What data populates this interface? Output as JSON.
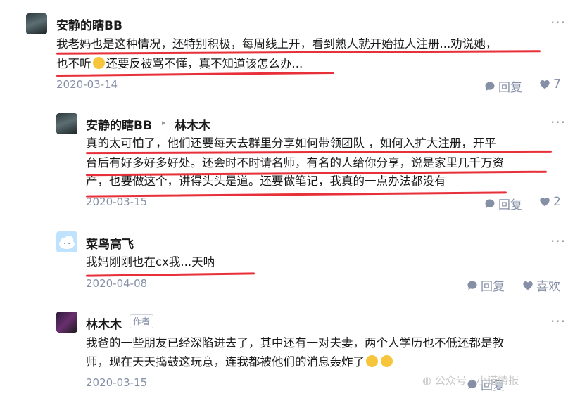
{
  "comments": [
    {
      "author": "安静的瞎BB",
      "text1": "我老妈也是这种情况，还特别积极，每周线上开，看到熟人就开始拉人注册...劝说她，",
      "text2a": "也不听",
      "text2b": "还要反被骂不懂，真不知道该怎么办...",
      "date": "2020-03-14",
      "reply_label": "回复",
      "likes": "7"
    },
    {
      "author": "安静的瞎BB",
      "reply_to": "林木木",
      "text1": "真的太可怕了，他们还要每天去群里分享如何带领团队 ，如何入扩大注册，开平",
      "text2": "台后有好多好多好处。还会时不时请名师，有名的人给你分享，说是家里几千万资",
      "text3": "产，也要做这个，讲得头头是道。还要做笔记，我真的一点办法都没有",
      "date": "2020-03-15",
      "reply_label": "回复",
      "likes": "2"
    },
    {
      "author": "菜鸟高飞",
      "text1": "我妈刚刚也在cx我...天呐",
      "date": "2020-04-08",
      "reply_label": "回复",
      "like_label": "喜欢"
    },
    {
      "author": "林木木",
      "badge": "作者",
      "text1": "我爸的一些朋友已经深陷进去了，其中还有一对夫妻，两个人学历也不低还都是教",
      "text2": "师，现在天天捣鼓这玩意，连我都被他们的消息轰炸了",
      "date": "2020-03-15",
      "reply_label": "回复"
    }
  ],
  "watermark": "公众号 · 小诺情报",
  "more_label": "···",
  "colors": {
    "underline": "#e8303a",
    "meta": "#8590a6"
  }
}
